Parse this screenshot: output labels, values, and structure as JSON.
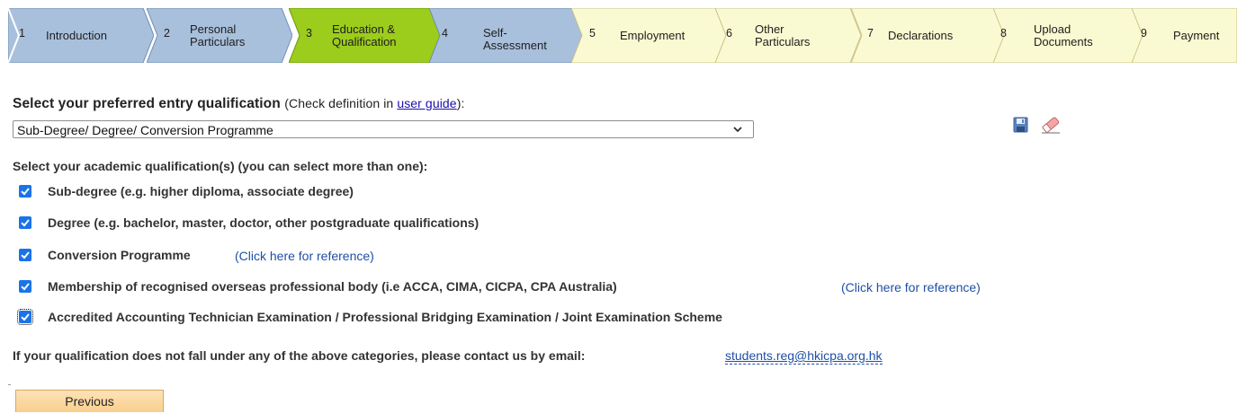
{
  "steps": [
    {
      "num": "1",
      "label": "Introduction",
      "fill": "#a9c0dc"
    },
    {
      "num": "2",
      "label": "Personal Particulars",
      "fill": "#a9c0dc"
    },
    {
      "num": "3",
      "label": "Education & Qualification",
      "fill": "#9ccc1c"
    },
    {
      "num": "4",
      "label": "Self-Assessment",
      "fill": "#a9c0dc"
    },
    {
      "num": "5",
      "label": "Employment",
      "fill": "#fafad2"
    },
    {
      "num": "6",
      "label": "Other Particulars",
      "fill": "#fafad2"
    },
    {
      "num": "7",
      "label": "Declarations",
      "fill": "#fafad2"
    },
    {
      "num": "8",
      "label": "Upload Documents",
      "fill": "#fafad2"
    },
    {
      "num": "9",
      "label": "Payment",
      "fill": "#fafad2"
    }
  ],
  "entry": {
    "heading": "Select your preferred entry qualification",
    "paren_before": "(Check definition in ",
    "link": "user guide",
    "paren_after": "):",
    "selected": "Sub-Degree/ Degree/ Conversion Programme"
  },
  "icons": {
    "save": "save-icon",
    "clear": "eraser-icon"
  },
  "academic": {
    "heading": "Select your academic qualification(s) (you can select more than one):",
    "options": [
      {
        "label": "Sub-degree (e.g. higher diploma, associate degree)",
        "checked": true
      },
      {
        "label": "Degree (e.g. bachelor, master, doctor, other postgraduate qualifications)",
        "checked": true
      },
      {
        "label": "Conversion Programme",
        "checked": true,
        "ref": "(Click here for reference)"
      },
      {
        "label": "Membership of recognised overseas professional body (i.e ACCA, CIMA, CICPA, CPA Australia)",
        "checked": true,
        "ref": "(Click here for reference)"
      },
      {
        "label": "Accredited Accounting Technician Examination / Professional Bridging Examination / Joint Examination Scheme",
        "checked": true
      }
    ]
  },
  "contact": {
    "text": "If your qualification does not fall under any of the above categories, please contact us by email:",
    "email": "students.reg@hkicpa.org.hk"
  },
  "buttons": {
    "previous": "Previous"
  },
  "colors": {
    "checkbox": "#1a73e8",
    "link": "#1f4fa5",
    "completed_step": "#a9c0dc",
    "current_step": "#9ccc1c",
    "pending_step": "#fafad2"
  }
}
